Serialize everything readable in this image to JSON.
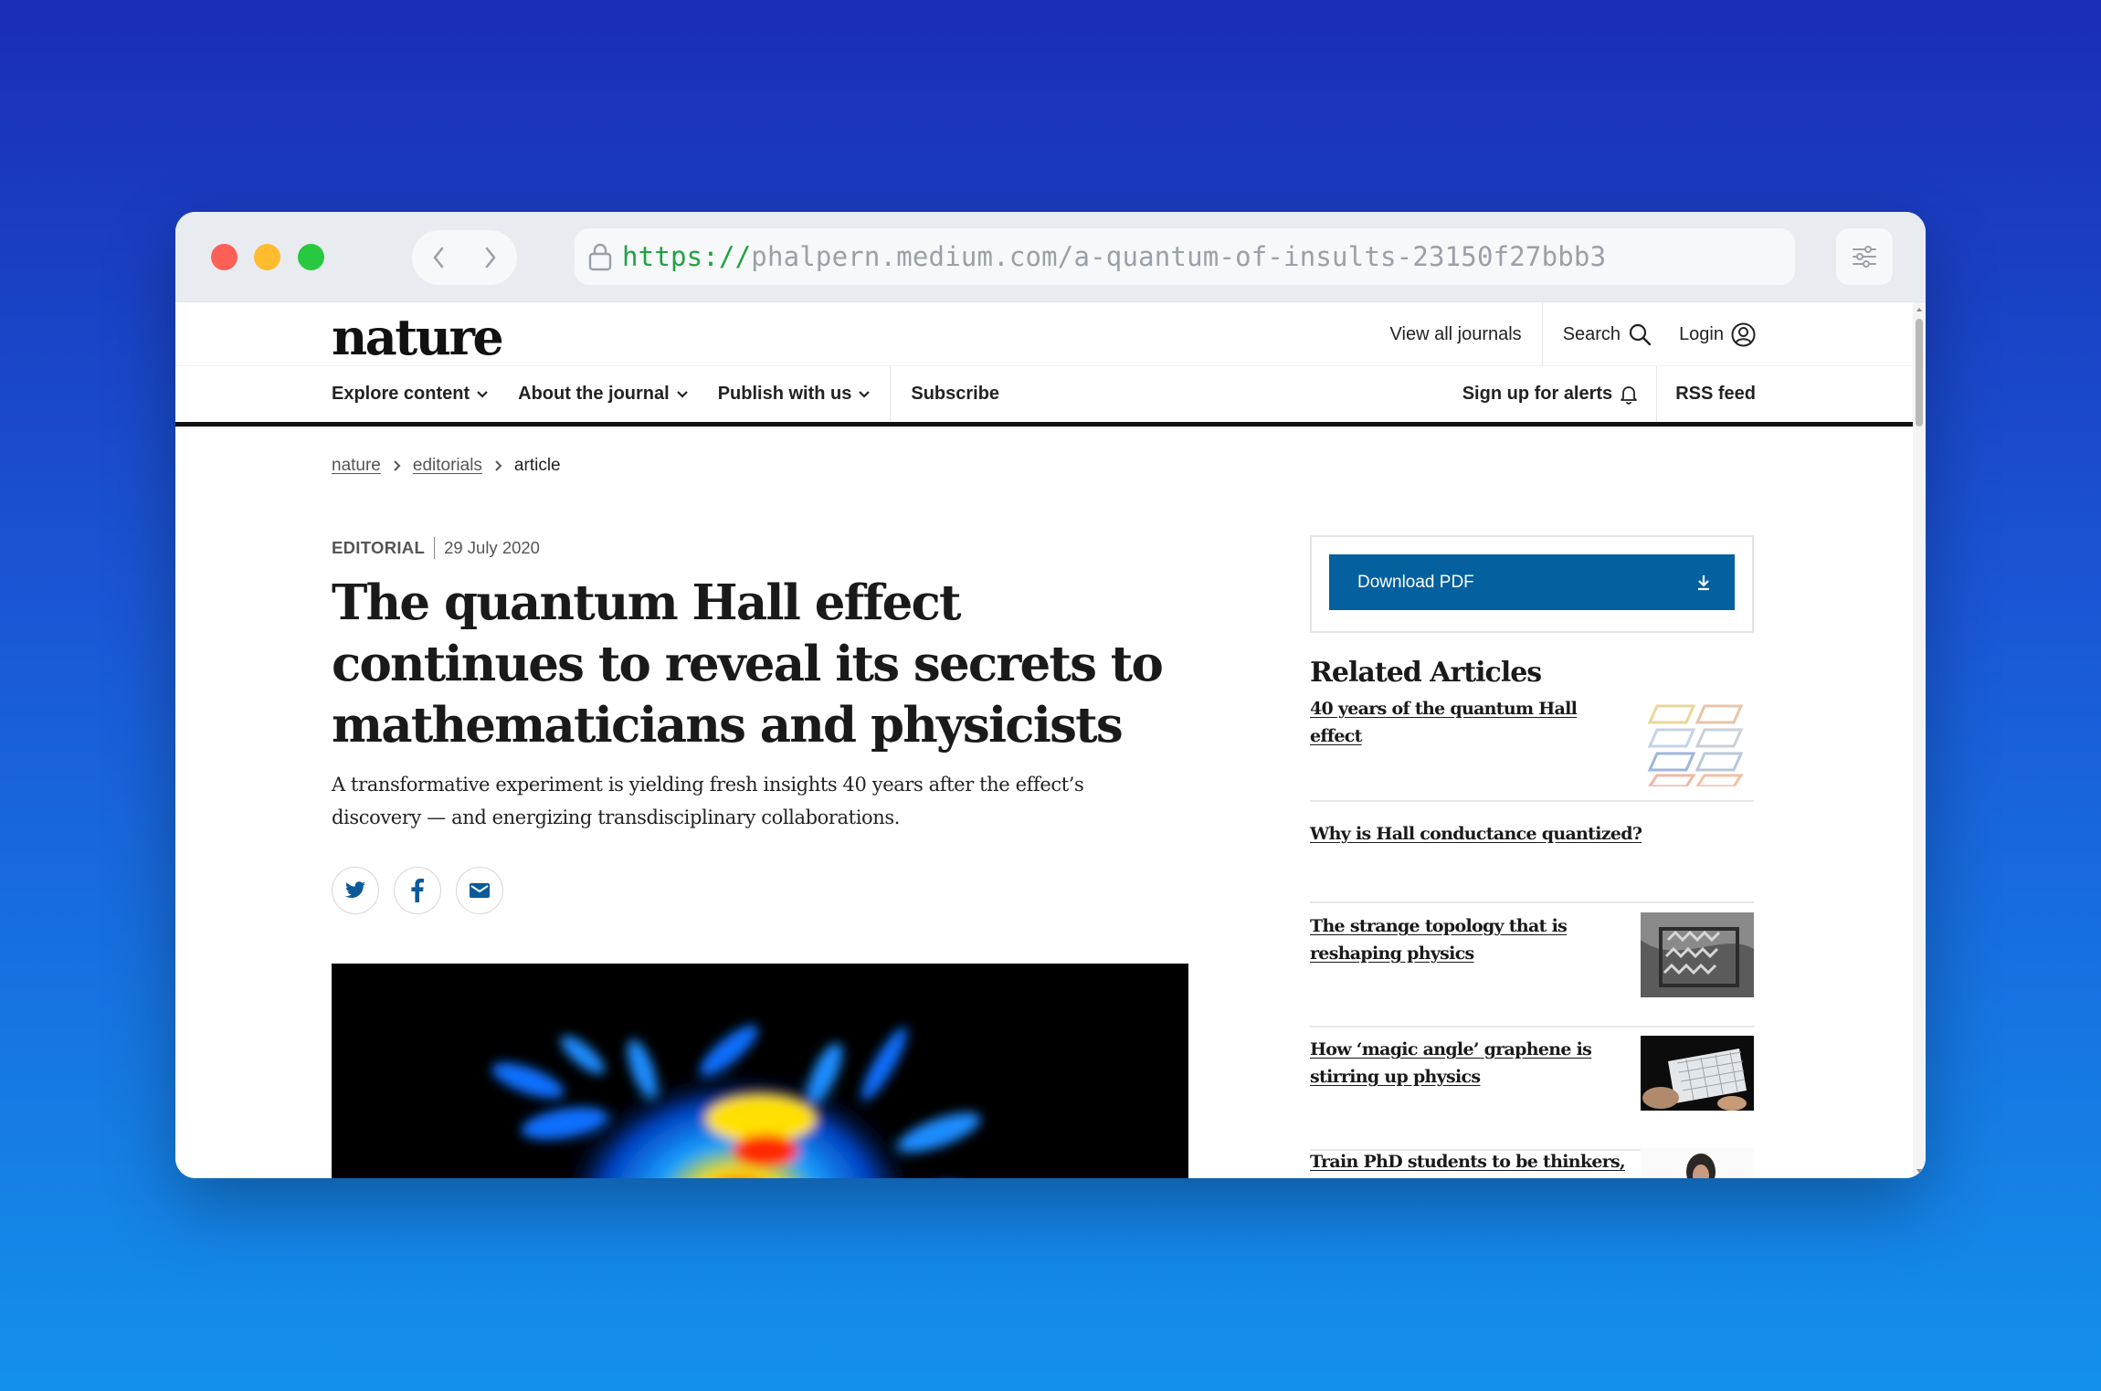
{
  "browser": {
    "url_scheme": "https://",
    "url_rest": "phalpern.medium.com/a-quantum-of-insults-23150f27bbb3"
  },
  "site": {
    "logo": "nature",
    "top_links": {
      "view_all": "View all journals",
      "search": "Search",
      "login": "Login"
    },
    "nav": {
      "explore": "Explore content",
      "about": "About the journal",
      "publish": "Publish with us",
      "subscribe": "Subscribe",
      "alerts": "Sign up for alerts",
      "rss": "RSS feed"
    }
  },
  "breadcrumb": [
    "nature",
    "editorials",
    "article"
  ],
  "article": {
    "type": "EDITORIAL",
    "date": "29 July 2020",
    "title": "The quantum Hall effect continues to reveal its secrets to mathematicians and physicists",
    "standfirst": "A transformative experiment is yielding fresh insights 40 years after the effect’s discovery — and energizing transdisciplinary collaborations."
  },
  "share": {
    "twitter": "twitter-icon",
    "facebook": "facebook-icon",
    "email": "email-icon"
  },
  "sidebar": {
    "download_pdf": "Download PDF",
    "related_heading": "Related Articles",
    "related": [
      "40 years of the quantum Hall effect",
      "Why is Hall conductance quantized?",
      "The strange topology that is reshaping physics",
      "How ‘magic angle’ graphene is stirring up physics",
      "Train PhD students to be thinkers, not"
    ]
  },
  "colors": {
    "pdf_button": "#04609e",
    "url_scheme": "#21a142"
  }
}
